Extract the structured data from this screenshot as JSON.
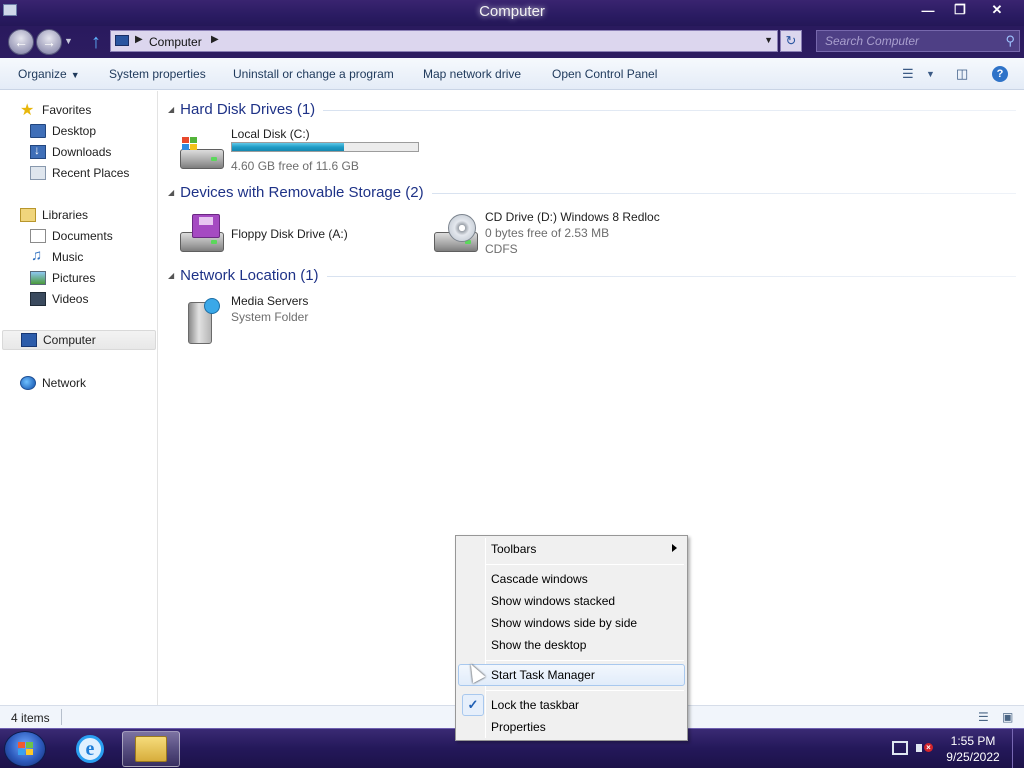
{
  "window": {
    "title": "Computer",
    "controls": {
      "minimize": "—",
      "maximize": "❐",
      "close": "✕"
    }
  },
  "address": {
    "path": [
      "Computer"
    ],
    "refresh_icon": "refresh-icon",
    "search_placeholder": "Search Computer"
  },
  "commands": {
    "organize": "Organize",
    "system_properties": "System properties",
    "uninstall": "Uninstall or change a program",
    "map_drive": "Map network drive",
    "control_panel": "Open Control Panel",
    "help": "?"
  },
  "navpane": {
    "favorites": "Favorites",
    "desktop": "Desktop",
    "downloads": "Downloads",
    "recent_places": "Recent Places",
    "libraries": "Libraries",
    "documents": "Documents",
    "music": "Music",
    "pictures": "Pictures",
    "videos": "Videos",
    "computer": "Computer",
    "network": "Network"
  },
  "groups": {
    "hdd": {
      "header": "Hard Disk Drives (1)",
      "local_disk": {
        "name": "Local Disk (C:)",
        "free": "4.60 GB free of 11.6 GB",
        "used_fraction": 0.6
      }
    },
    "removable": {
      "header": "Devices with Removable Storage (2)",
      "floppy": {
        "name": "Floppy Disk Drive (A:)"
      },
      "cd": {
        "name": "CD Drive (D:) Windows 8 Redloc",
        "free": "0 bytes free of 2.53 MB",
        "fs": "CDFS"
      }
    },
    "network": {
      "header": "Network Location (1)",
      "media": {
        "name": "Media Servers",
        "type": "System Folder"
      }
    }
  },
  "status": {
    "count": "4 items"
  },
  "context_menu": {
    "toolbars": "Toolbars",
    "cascade": "Cascade windows",
    "stacked": "Show windows stacked",
    "side_by_side": "Show windows side by side",
    "show_desktop": "Show the desktop",
    "task_manager": "Start Task Manager",
    "lock": "Lock the taskbar",
    "lock_checked": "✓",
    "properties": "Properties"
  },
  "taskbar": {
    "ie_glyph": "e",
    "time": "1:55 PM",
    "date": "9/25/2022"
  },
  "colors": {
    "title_bar": "#2b1c63",
    "progress": "#1f9cc6",
    "group_header": "#1e3287",
    "taskbar": "#24185a"
  }
}
